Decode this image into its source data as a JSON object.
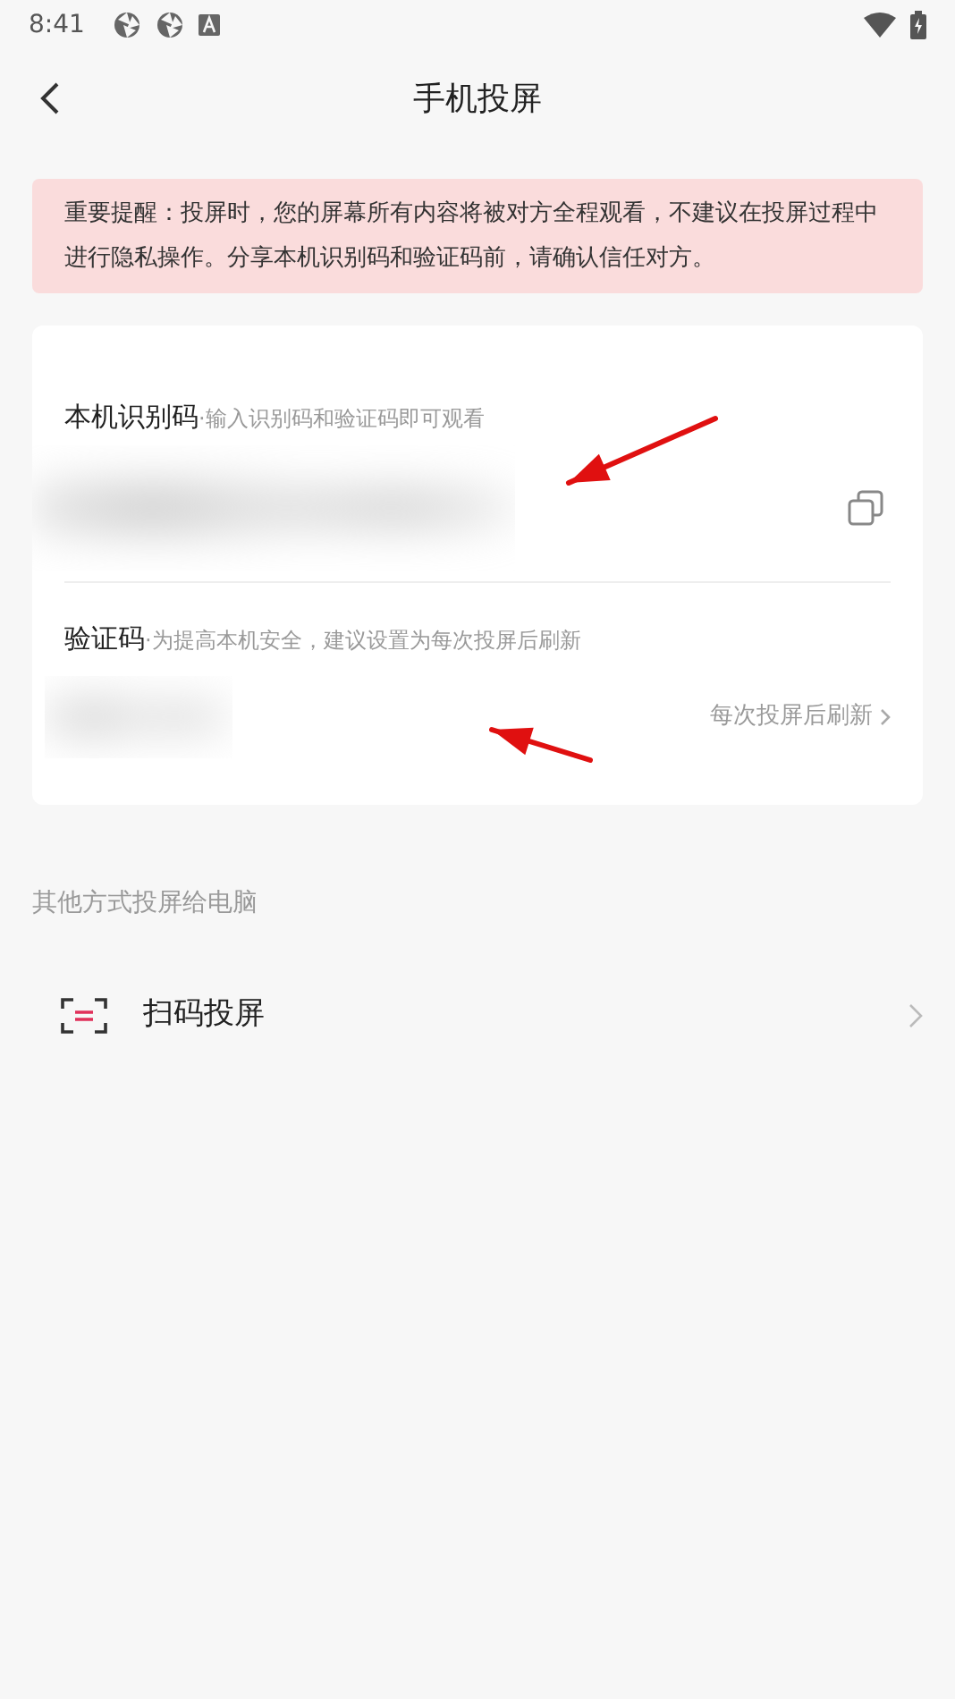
{
  "status_bar": {
    "time": "8:41"
  },
  "header": {
    "title": "手机投屏"
  },
  "notice": {
    "text": "重要提醒：投屏时，您的屏幕所有内容将被对方全程观看，不建议在投屏过程中进行隐私操作。分享本机识别码和验证码前，请确认信任对方。"
  },
  "codes": [
    {
      "kind": "device",
      "label": "本机识别码",
      "hint": "·输入识别码和验证码即可观看"
    },
    {
      "kind": "verify",
      "label": "验证码",
      "hint": "·为提高本机安全，建议设置为每次投屏后刷新",
      "action": "每次投屏后刷新"
    }
  ],
  "other_section": {
    "title": "其他方式投屏给电脑",
    "items": [
      {
        "label": "扫码投屏"
      }
    ]
  }
}
